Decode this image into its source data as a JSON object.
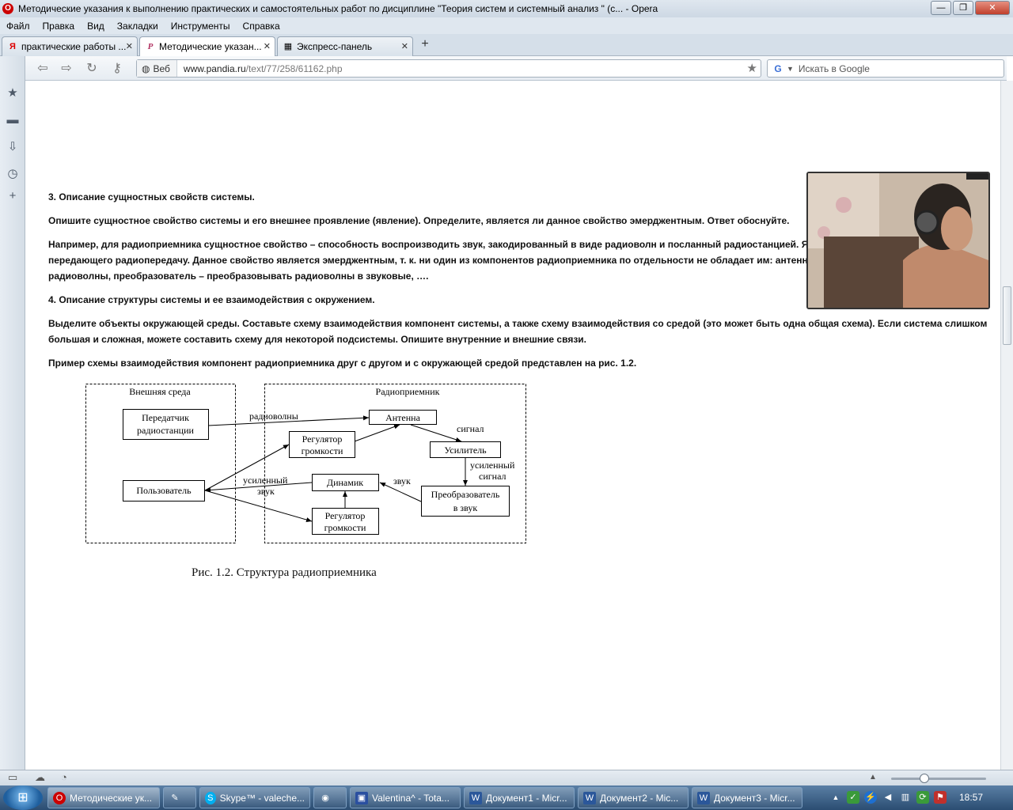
{
  "window": {
    "title": "Методические указания к выполнению практических и самостоятельных работ по дисциплине \"Теория систем и системный анализ \" (с... - Opera",
    "minimize_label": "—",
    "maximize_label": "❐",
    "close_label": "✕"
  },
  "menu": [
    "Файл",
    "Правка",
    "Вид",
    "Закладки",
    "Инструменты",
    "Справка"
  ],
  "tabs": [
    {
      "label": "практические работы ...",
      "icon": "Я"
    },
    {
      "label": "Методические указан...",
      "icon": "P"
    },
    {
      "label": "Экспресс-панель",
      "icon": "▦"
    }
  ],
  "address": {
    "badge": "Веб",
    "url_domain": "www.pandia.ru",
    "url_path": "/text/77/258/61162.php"
  },
  "search": {
    "placeholder": "Искать в Google"
  },
  "article": {
    "p1": "3. Описание сущностных свойств системы.",
    "p2": "Опишите сущностное свойство системы и его внешнее проявление (явление). Определите, является ли данное свойство эмерджентным. Ответ обоснуйте.",
    "p3": "Например, для радиоприемника сущностное свойство – способность воспроизводить звук, закодированный в виде радиоволн и посланный радиостанцией. Явле",
    "p4": "передающего радиопередачу. Данное свойство является эмерджентным, т. к. ни один из компонентов радиоприемника по отдельности не обладает им: антенна с",
    "p5": "радиоволны, преобразователь – преобразовывать радиоволны в звуковые, ….",
    "p6": "4. Описание структуры системы и ее взаимодействия с окружением.",
    "p7": "Выделите объекты окружающей среды. Составьте схему взаимодействия компонент системы, а также схему взаимодействия со средой (это может быть одна общая схема). Если система слишком",
    "p8": "большая и сложная, можете составить схему для некоторой подсистемы. Опишите внутренние и внешние связи.",
    "p9": "Пример схемы взаимодействия компонент радиоприемника друг с другом и с окружающей средой представлен на рис. 1.2.",
    "caption": "Рис. 1.2. Структура радиоприемника"
  },
  "diagram": {
    "env_title": "Внешняя среда",
    "radio_title": "Радиоприемник",
    "transmitter": [
      "Передатчик",
      "радиостанции"
    ],
    "user": "Пользователь",
    "antenna": "Антенна",
    "volume1": [
      "Регулятор",
      "громкости"
    ],
    "amplifier": "Усилитель",
    "speaker": "Динамик",
    "converter": [
      "Преобразователь",
      "в звук"
    ],
    "volume2": [
      "Регулятор",
      "громкости"
    ],
    "lbl_radiowaves": "радиоволны",
    "lbl_signal": "сигнал",
    "lbl_amp_signal": [
      "усиленный",
      "сигнал"
    ],
    "lbl_sound": "звук",
    "lbl_amp_sound": [
      "усиленный",
      "звук"
    ]
  },
  "taskbar": {
    "start_icon": "windows-orb",
    "items": [
      {
        "label": "Методические ук...",
        "icon": "O"
      },
      {
        "label": "",
        "icon": "✎"
      },
      {
        "label": "Skype™ - valeche...",
        "icon": "S"
      },
      {
        "label": "",
        "icon": "◉"
      },
      {
        "label": "Valentina^ - Tota...",
        "icon": "▣"
      },
      {
        "label": "Документ1 - Micr...",
        "icon": "W"
      },
      {
        "label": "Документ2 - Mic...",
        "icon": "W"
      },
      {
        "label": "Документ3 - Micr...",
        "icon": "W"
      }
    ],
    "clock": "18:57"
  }
}
